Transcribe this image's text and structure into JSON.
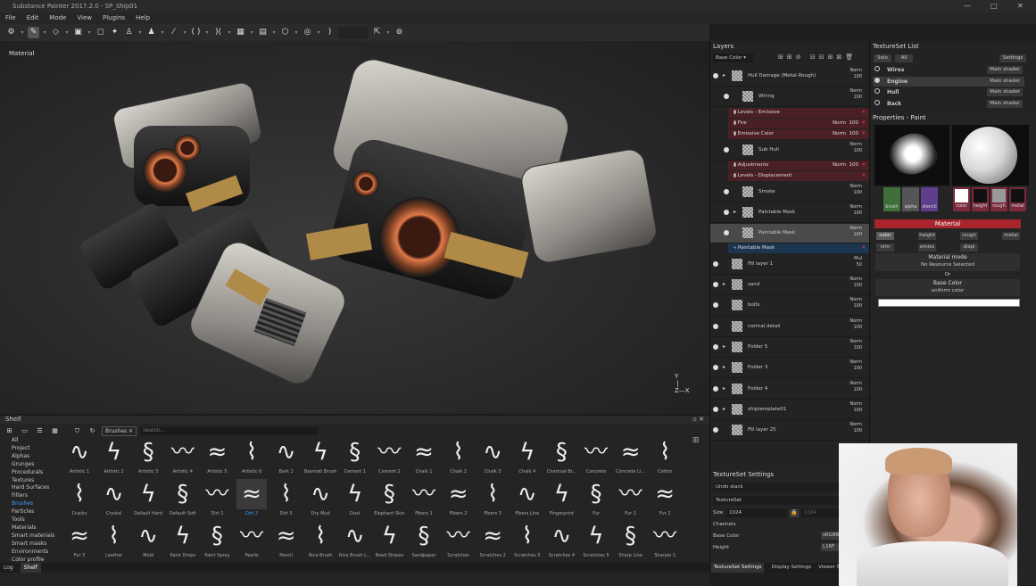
{
  "window": {
    "title": "Substance Painter 2017.2.0 - SP_Ship01",
    "controls": [
      "—",
      "□",
      "✕"
    ]
  },
  "menu": [
    "File",
    "Edit",
    "Mode",
    "View",
    "Plugins",
    "Help"
  ],
  "viewport": {
    "label": "Material"
  },
  "shelf": {
    "title": "Shelf",
    "filter_tag": "Brushes",
    "search_placeholder": "Search...",
    "categories": [
      "All",
      "Project",
      "Alphas",
      "Grunges",
      "Procedurals",
      "Textures",
      "Hard Surfaces",
      "Filters",
      "Brushes",
      "Particles",
      "Tools",
      "Materials",
      "Smart materials",
      "Smart masks",
      "Environments",
      "Color profile"
    ],
    "active_category": "Brushes",
    "brushes": [
      [
        "Artistic 1",
        "Artistic 2",
        "Artistic 3",
        "Artistic 4",
        "Artistic 5",
        "Artistic 6",
        "Bark 1",
        "Basmati Brush",
        "Cement 1",
        "Cement 2",
        "Chalk 1",
        "Chalk 2",
        "Chalk 3",
        "Chalk 4",
        "Charcoal Br...",
        "Concrete",
        "Concrete Li...",
        "Cotton"
      ],
      [
        "Cracks",
        "Crystal",
        "Default Hard",
        "Default Soft",
        "Dirt 1",
        "Dirt 2",
        "Dirt 3",
        "Dry Mud",
        "Dust",
        "Elephant Skin",
        "Fibers 1",
        "Fibers 2",
        "Fibers 3",
        "Fibers Line",
        "Fingerprint",
        "Fur",
        "Fur 1",
        "Fur 2"
      ],
      [
        "Fur 3",
        "Leather",
        "Mold",
        "Paint Drops",
        "Paint Spray",
        "Pearls",
        "Pencil",
        "Rice Brush",
        "Rice Brush L...",
        "Road Stripes",
        "Sandpaper",
        "Scratches",
        "Scratches 2",
        "Scratches 3",
        "Scratches 4",
        "Scratches 5",
        "Sharp Line",
        "Sharpie 1"
      ]
    ],
    "selected_brush": "Dirt 2"
  },
  "bottom_tabs": [
    "Log",
    "Shelf"
  ],
  "layers": {
    "title": "Layers",
    "channel": "Base Color",
    "items": [
      {
        "name": "Hull Damage (Metal-Rough)",
        "blend": "Norm",
        "opacity": "100",
        "kind": "folder"
      },
      {
        "name": "Wiring",
        "blend": "Norm",
        "opacity": "100",
        "kind": "fill"
      },
      {
        "name": "Levels - Emissive",
        "kind": "effect"
      },
      {
        "name": "Fire",
        "blend": "Norm",
        "opacity": "100",
        "kind": "effect"
      },
      {
        "name": "Emissive Color",
        "blend": "Norm",
        "opacity": "100",
        "kind": "effect"
      },
      {
        "name": "Sub Hull",
        "blend": "Norm",
        "opacity": "100",
        "kind": "fill"
      },
      {
        "name": "Adjustments",
        "blend": "Norm",
        "opacity": "100",
        "kind": "effect"
      },
      {
        "name": "Levels - Displacement",
        "kind": "effect"
      },
      {
        "name": "Smoke",
        "blend": "Norm",
        "opacity": "100",
        "kind": "fill"
      },
      {
        "name": "Paintable Mask",
        "blend": "Norm",
        "opacity": "100",
        "kind": "folder"
      },
      {
        "name": "Paintable Mask",
        "blend": "Norm",
        "opacity": "100",
        "kind": "paint"
      },
      {
        "name": "Paintable Mask",
        "kind": "mask"
      },
      {
        "name": "Fill layer 1",
        "blend": "Mul",
        "opacity": "50",
        "kind": "fill"
      },
      {
        "name": "sand",
        "blend": "Norm",
        "opacity": "100",
        "kind": "folder"
      },
      {
        "name": "bolts",
        "blend": "Norm",
        "opacity": "100",
        "kind": "fill"
      },
      {
        "name": "normal detail",
        "blend": "Norm",
        "opacity": "100",
        "kind": "fill"
      },
      {
        "name": "Folder 5",
        "blend": "Norm",
        "opacity": "100",
        "kind": "folder"
      },
      {
        "name": "Folder 3",
        "blend": "Norm",
        "opacity": "100",
        "kind": "folder"
      },
      {
        "name": "Folder 4",
        "blend": "Norm",
        "opacity": "100",
        "kind": "folder"
      },
      {
        "name": "shiptemplate01",
        "blend": "Norm",
        "opacity": "100",
        "kind": "folder"
      },
      {
        "name": "Fill layer 25",
        "blend": "Norm",
        "opacity": "100",
        "kind": "fill"
      }
    ]
  },
  "textureset_settings": {
    "title": "TextureSet Settings",
    "undo": "Undo stack",
    "section": "TextureSet",
    "size_label": "Size",
    "size_value": "1024",
    "size_value2": "1024",
    "channels_label": "Channels",
    "base_color_label": "Base Color",
    "base_color_format": "sRGB8",
    "height_label": "Height",
    "height_format": "L16F",
    "tabs": [
      "TextureSet Settings",
      "Display Settings",
      "Viewer Settings"
    ]
  },
  "textureset_list": {
    "title": "TextureSet List",
    "solo": "Solo",
    "all": "All",
    "settings": "Settings",
    "items": [
      {
        "name": "Wires",
        "shader": "Main shader"
      },
      {
        "name": "Engine",
        "shader": "Main shader"
      },
      {
        "name": "Hull",
        "shader": "Main shader"
      },
      {
        "name": "Back",
        "shader": "Main shader"
      }
    ]
  },
  "properties": {
    "title": "Properties - Paint",
    "slots_left": [
      "brush",
      "alpha",
      "stencil"
    ],
    "slots_right": [
      "color",
      "height",
      "rough",
      "metal"
    ],
    "material_title": "Material",
    "channels_row1": [
      "color",
      "height",
      "rough",
      "metal"
    ],
    "channels_row2": [
      "nrm",
      "emiss",
      "displ"
    ],
    "material_mode_label": "Material mode",
    "material_mode_value": "No Resource Selected",
    "or": "Or",
    "base_color_label": "Base Color",
    "base_color_mode": "uniform color"
  },
  "colors": {
    "accent": "#3aa0ff",
    "effect_row": "#4a2024",
    "material_bar": "#a8252d"
  }
}
